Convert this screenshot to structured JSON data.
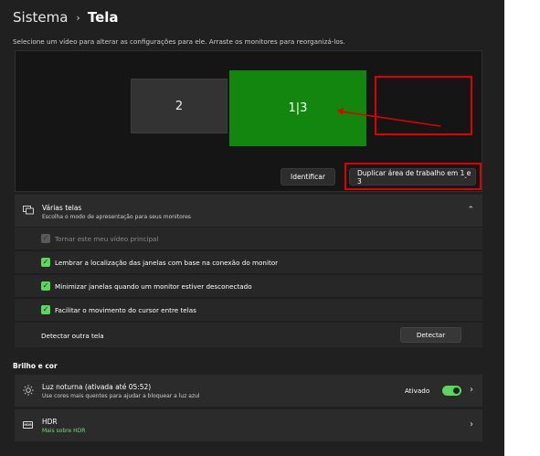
{
  "breadcrumb": {
    "parent": "Sistema",
    "separator": "›",
    "current": "Tela"
  },
  "subtitle": "Selecione um vídeo para alterar as configurações para ele. Arraste os monitores para reorganizá-los.",
  "arrangement": {
    "monitors": [
      {
        "label": "2",
        "color": "#333333"
      },
      {
        "label": "1|3",
        "color": "#13860f"
      }
    ],
    "identify_label": "Identificar",
    "duplicate_label": "Duplicar área de trabalho em 1 e 3",
    "annotation_color": "#e00000"
  },
  "multiple_displays": {
    "title": "Várias telas",
    "description": "Escolha o modo de apresentação para seus monitores",
    "options": [
      {
        "label": "Tornar este meu vídeo principal",
        "checked": true,
        "disabled": true
      },
      {
        "label": "Lembrar a localização das janelas com base na conexão do monitor",
        "checked": true,
        "disabled": false
      },
      {
        "label": "Minimizar janelas quando um monitor estiver desconectado",
        "checked": true,
        "disabled": false
      },
      {
        "label": "Facilitar o movimento do cursor entre telas",
        "checked": true,
        "disabled": false
      }
    ],
    "detect_other": "Detectar outra tela",
    "detect_button": "Detectar"
  },
  "brightness_section": {
    "title": "Brilho e cor"
  },
  "night_light": {
    "title": "Luz noturna (ativada até 05:52)",
    "description": "Use cores mais quentes para ajudar a bloquear a luz azul",
    "state": "Ativado",
    "on": true
  },
  "hdr": {
    "badge": "HDR",
    "title": "HDR",
    "link": "Mais sobre HDR"
  },
  "colors": {
    "accent": "#5cd65c",
    "background": "#202020",
    "card": "#2b2b2b"
  }
}
